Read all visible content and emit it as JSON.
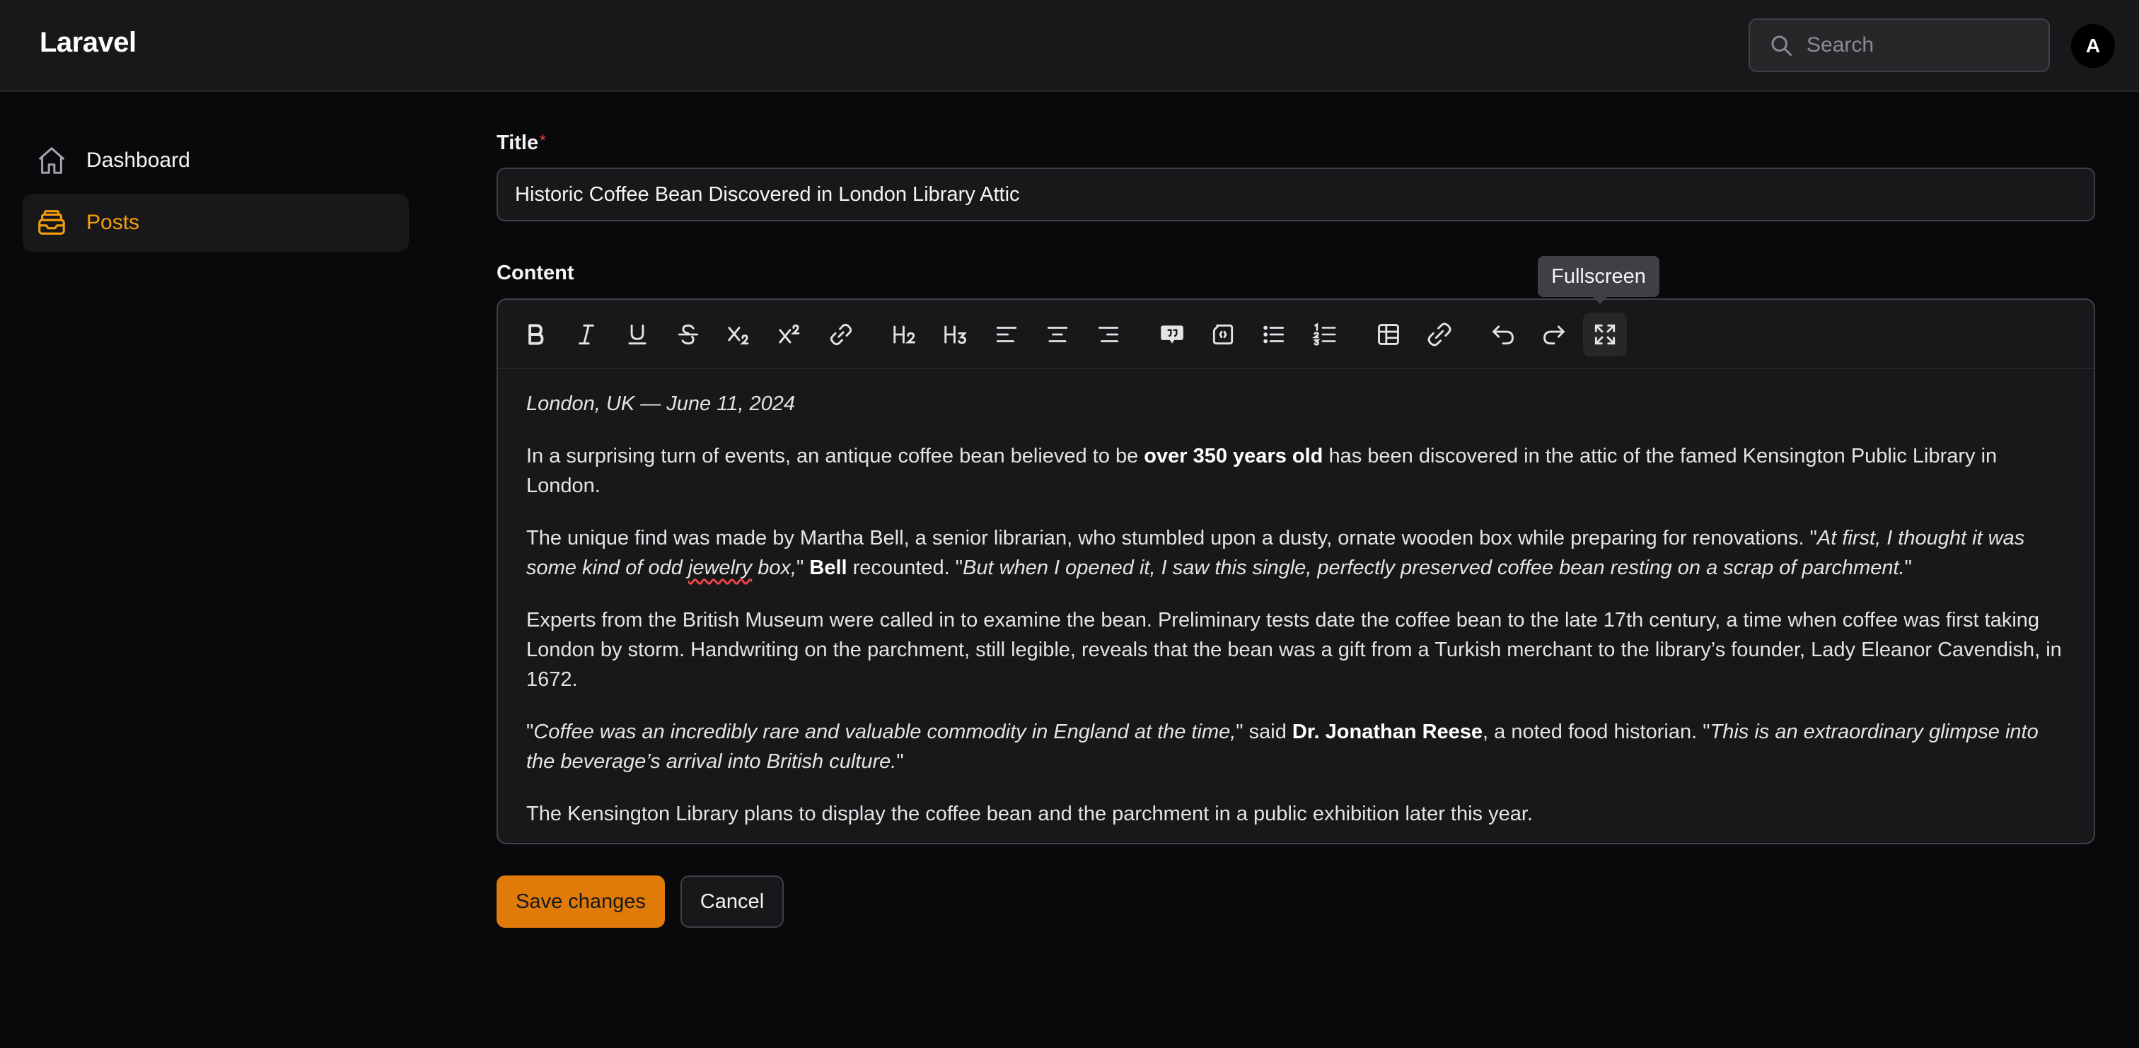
{
  "header": {
    "brand": "Laravel",
    "search_placeholder": "Search",
    "avatar_initial": "A"
  },
  "sidebar": {
    "items": [
      {
        "label": "Dashboard",
        "icon": "home-icon",
        "active": false
      },
      {
        "label": "Posts",
        "icon": "inbox-stack-icon",
        "active": true
      }
    ]
  },
  "form": {
    "title_label": "Title",
    "required_mark": "*",
    "title_value": "Historic Coffee Bean Discovered in London Library Attic",
    "content_label": "Content",
    "tooltip": "Fullscreen"
  },
  "toolbar": {
    "buttons": [
      "bold-icon",
      "italic-icon",
      "underline-icon",
      "strikethrough-icon",
      "subscript-icon",
      "superscript-icon",
      "link-icon",
      "heading-2-icon",
      "heading-3-icon",
      "align-left-icon",
      "align-center-icon",
      "align-right-icon",
      "blockquote-icon",
      "code-block-icon",
      "bullet-list-icon",
      "ordered-list-icon",
      "table-icon",
      "attach-link-icon",
      "undo-icon",
      "redo-icon",
      "fullscreen-icon"
    ]
  },
  "content": {
    "dateline": "London, UK — June 11, 2024",
    "p1": {
      "a": "In a surprising turn of events, an antique coffee bean believed to be ",
      "b": "over 350 years old",
      "c": " has been discovered in the attic of the famed Kensington Public Library in London."
    },
    "p2": {
      "a": "The unique find was made by Martha Bell, a senior librarian, who stumbled upon a dusty, ornate wooden box while preparing for renovations. \"",
      "b": "At first, I thought it was some kind of odd ",
      "c": "jewelry",
      "d": " box,",
      "e": "\" ",
      "f": "Bell",
      "g": " recounted. \"",
      "h": "But when I opened it, I saw this single, perfectly preserved coffee bean resting on a scrap of parchment.",
      "i": "\""
    },
    "p3": "Experts from the British Museum were called in to examine the bean. Preliminary tests date the coffee bean to the late 17th century, a time when coffee was first taking London by storm. Handwriting on the parchment, still legible, reveals that the bean was a gift from a Turkish merchant to the library’s founder, Lady Eleanor Cavendish, in 1672.",
    "p4": {
      "a": "\"",
      "b": "Coffee was an incredibly rare and valuable commodity in England at the time,",
      "c": "\" said ",
      "d": "Dr. Jonathan Reese",
      "e": ", a noted food historian. \"",
      "f": "This is an extraordinary glimpse into the beverage’s arrival into British culture.",
      "g": "\""
    },
    "p5": "The Kensington Library plans to display the coffee bean and the parchment in a public exhibition later this year."
  },
  "actions": {
    "save_label": "Save changes",
    "cancel_label": "Cancel"
  },
  "colors": {
    "accent": "#f59e0b",
    "primary_button": "#e07b0a",
    "background": "#09090b",
    "surface": "#18181b"
  }
}
